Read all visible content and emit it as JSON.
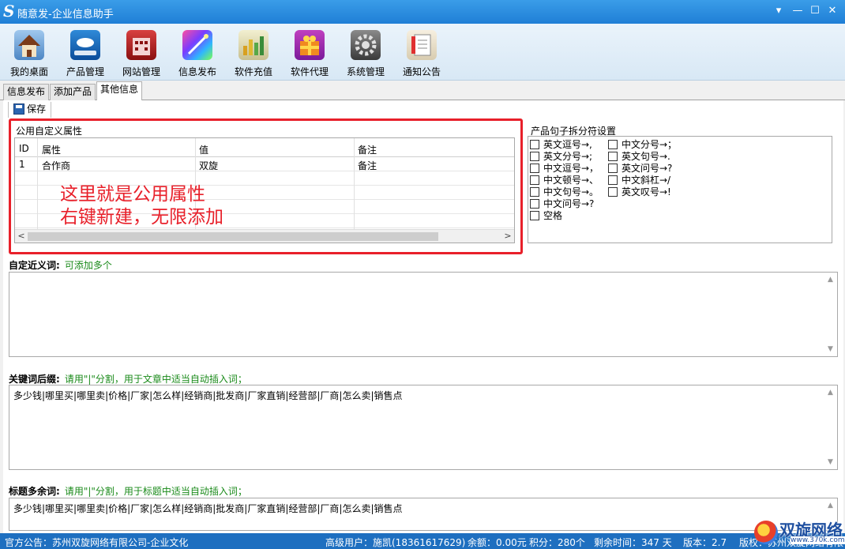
{
  "window": {
    "logo": "S",
    "title": "随意发-企业信息助手",
    "controls": [
      "▾",
      "—",
      "☐",
      "✕"
    ]
  },
  "toolbar": {
    "items": [
      {
        "label": "我的桌面",
        "icon": "house-icon"
      },
      {
        "label": "产品管理",
        "icon": "cloud-drive-icon"
      },
      {
        "label": "网站管理",
        "icon": "building-icon"
      },
      {
        "label": "信息发布",
        "icon": "magic-wand-icon"
      },
      {
        "label": "软件充值",
        "icon": "bar-chart-icon"
      },
      {
        "label": "软件代理",
        "icon": "gift-box-icon"
      },
      {
        "label": "系统管理",
        "icon": "gear-icon"
      },
      {
        "label": "通知公告",
        "icon": "notebook-icon"
      }
    ]
  },
  "tabs": [
    "信息发布",
    "添加产品",
    "其他信息"
  ],
  "save_label": "保存",
  "custom_attrs": {
    "group_title": "公用自定义属性",
    "columns": [
      "ID",
      "属性",
      "值",
      "备注"
    ],
    "rows": [
      {
        "id": "1",
        "attr": "合作商",
        "value": "双旋",
        "note": "备注"
      }
    ],
    "overlay_line1": "这里就是公用属性",
    "overlay_line2": "右键新建，无限添加"
  },
  "separator": {
    "group_title": "产品句子拆分符设置",
    "col1": [
      "英文逗号→,",
      "英文分号→;",
      "中文逗号→，",
      "中文顿号→、",
      "中文句号→。",
      "中文问号→?",
      "空格"
    ],
    "col2": [
      "中文分号→；",
      "英文句号→.",
      "英文问号→?",
      "中文斜杠→/",
      "英文叹号→!"
    ]
  },
  "synonyms": {
    "label": "自定近义词:",
    "hint": "可添加多个",
    "value": ""
  },
  "keyword_suffix": {
    "label": "关键词后缀:",
    "hint": "请用\"|\"分割，用于文章中适当自动插入词；",
    "value": "多少钱|哪里买|哪里卖|价格|厂家|怎么样|经销商|批发商|厂家直销|经营部|厂商|怎么卖|销售点"
  },
  "title_extra": {
    "label": "标题多余词:",
    "hint": "请用\"|\"分割，用于标题中适当自动插入词；",
    "value": "多少钱|哪里买|哪里卖|价格|厂家|怎么样|经销商|批发商|厂家直销|经营部|厂商|怎么卖|销售点"
  },
  "statusbar": {
    "notice": "官方公告：苏州双旋网络有限公司-企业文化",
    "user": "高级用户：施凯(18361617629)",
    "balance": "余额：0.00元",
    "points": "积分：280个",
    "remaining": "剩余时间：347 天",
    "version": "版本：2.7",
    "copyright": "版权：苏州双旋网络有限"
  },
  "watermark": {
    "name": "双旋网络",
    "url": "www.370k.com"
  },
  "colors": {
    "accent": "#1e6fc0",
    "highlight": "#e8202a",
    "hint": "#1a8a1a"
  }
}
